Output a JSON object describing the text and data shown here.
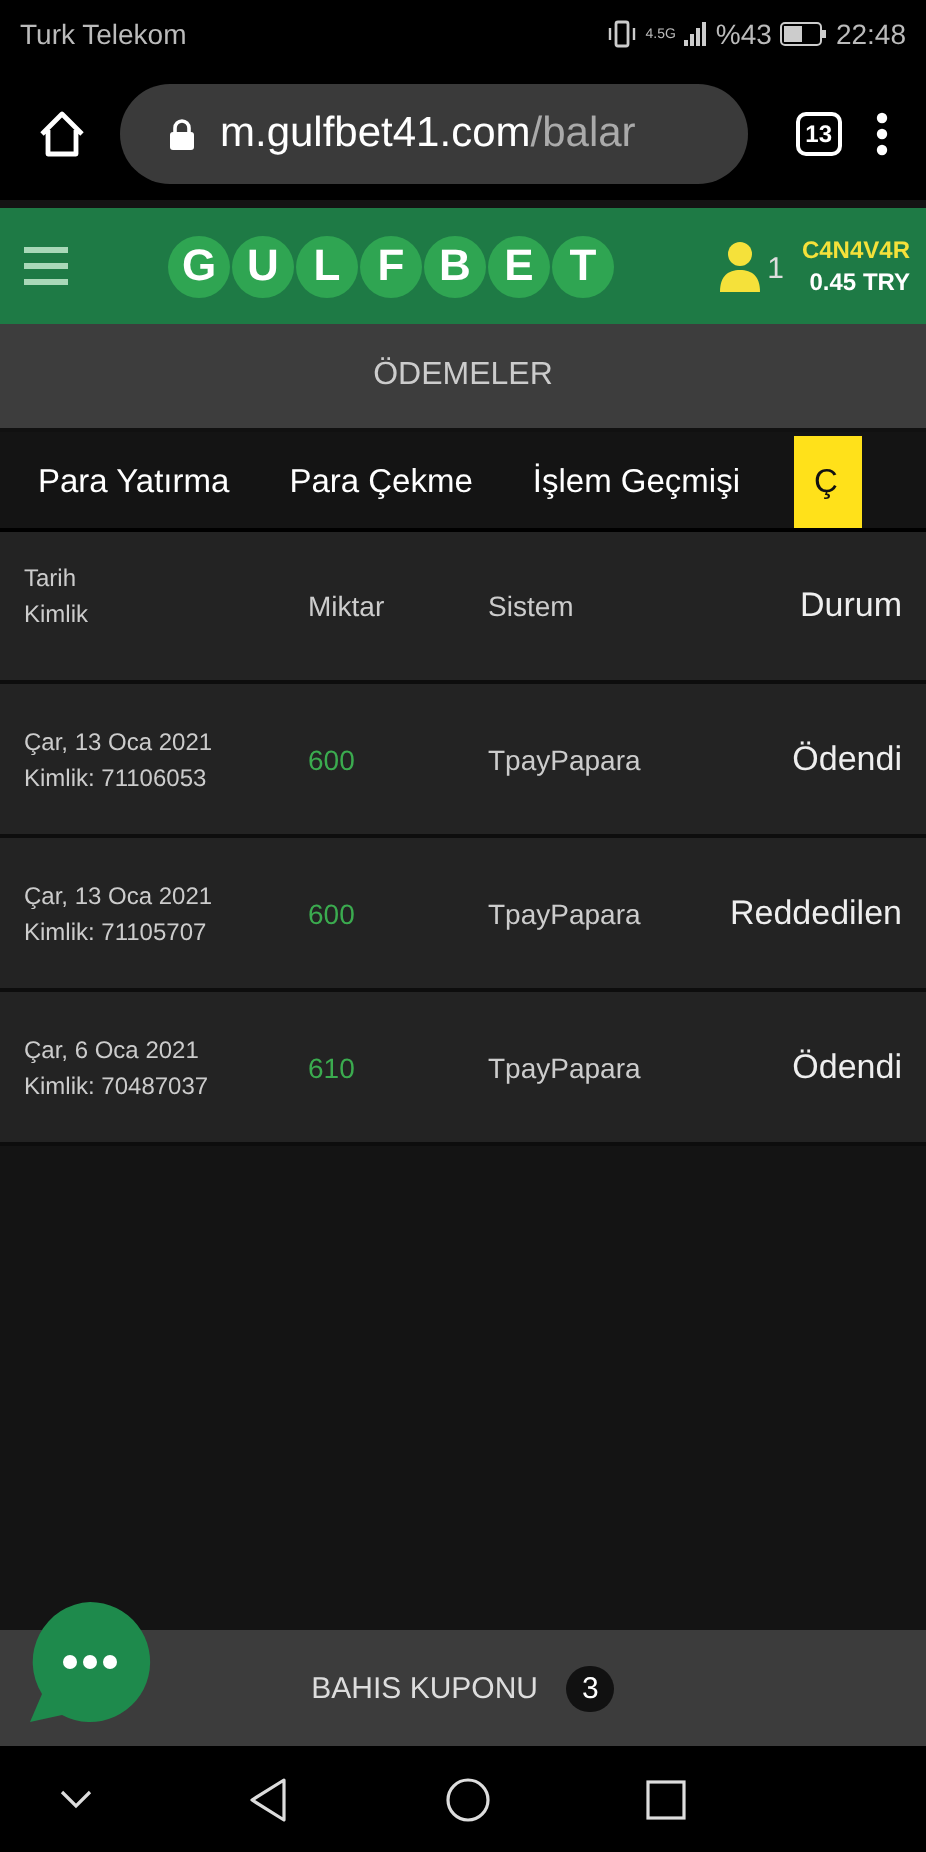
{
  "status_bar": {
    "carrier": "Turk Telekom",
    "network": "4.5G",
    "battery": "%43",
    "time": "22:48"
  },
  "browser": {
    "url_host": "m.gulfbet41.com",
    "url_path": "/balar",
    "tab_count": "13"
  },
  "header": {
    "logo": [
      "G",
      "U",
      "L",
      "F",
      "B",
      "E",
      "T"
    ],
    "user_count": "1",
    "username": "C4N4V4R",
    "balance": "0.45 TRY"
  },
  "page_title": "ÖDEMELER",
  "tabs": [
    {
      "label": "Para Yatırma",
      "selected": false
    },
    {
      "label": "Para Çekme",
      "selected": false
    },
    {
      "label": "İşlem Geçmişi",
      "selected": false
    },
    {
      "label": "Ç",
      "selected": true
    }
  ],
  "table": {
    "columns": [
      "Tarih",
      "Kimlik",
      "Miktar",
      "Sistem",
      "Durum"
    ],
    "rows": [
      {
        "date": "Çar, 13 Oca 2021",
        "id": "Kimlik: 71106053",
        "amount": "600",
        "system": "TpayPapara",
        "status": "Ödendi"
      },
      {
        "date": "Çar, 13 Oca 2021",
        "id": "Kimlik: 71105707",
        "amount": "600",
        "system": "TpayPapara",
        "status": "Reddedilen"
      },
      {
        "date": "Çar, 6 Oca 2021",
        "id": "Kimlik: 70487037",
        "amount": "610",
        "system": "TpayPapara",
        "status": "Ödendi"
      }
    ]
  },
  "coupon": {
    "label": "BAHIS KUPONU",
    "count": "3"
  }
}
